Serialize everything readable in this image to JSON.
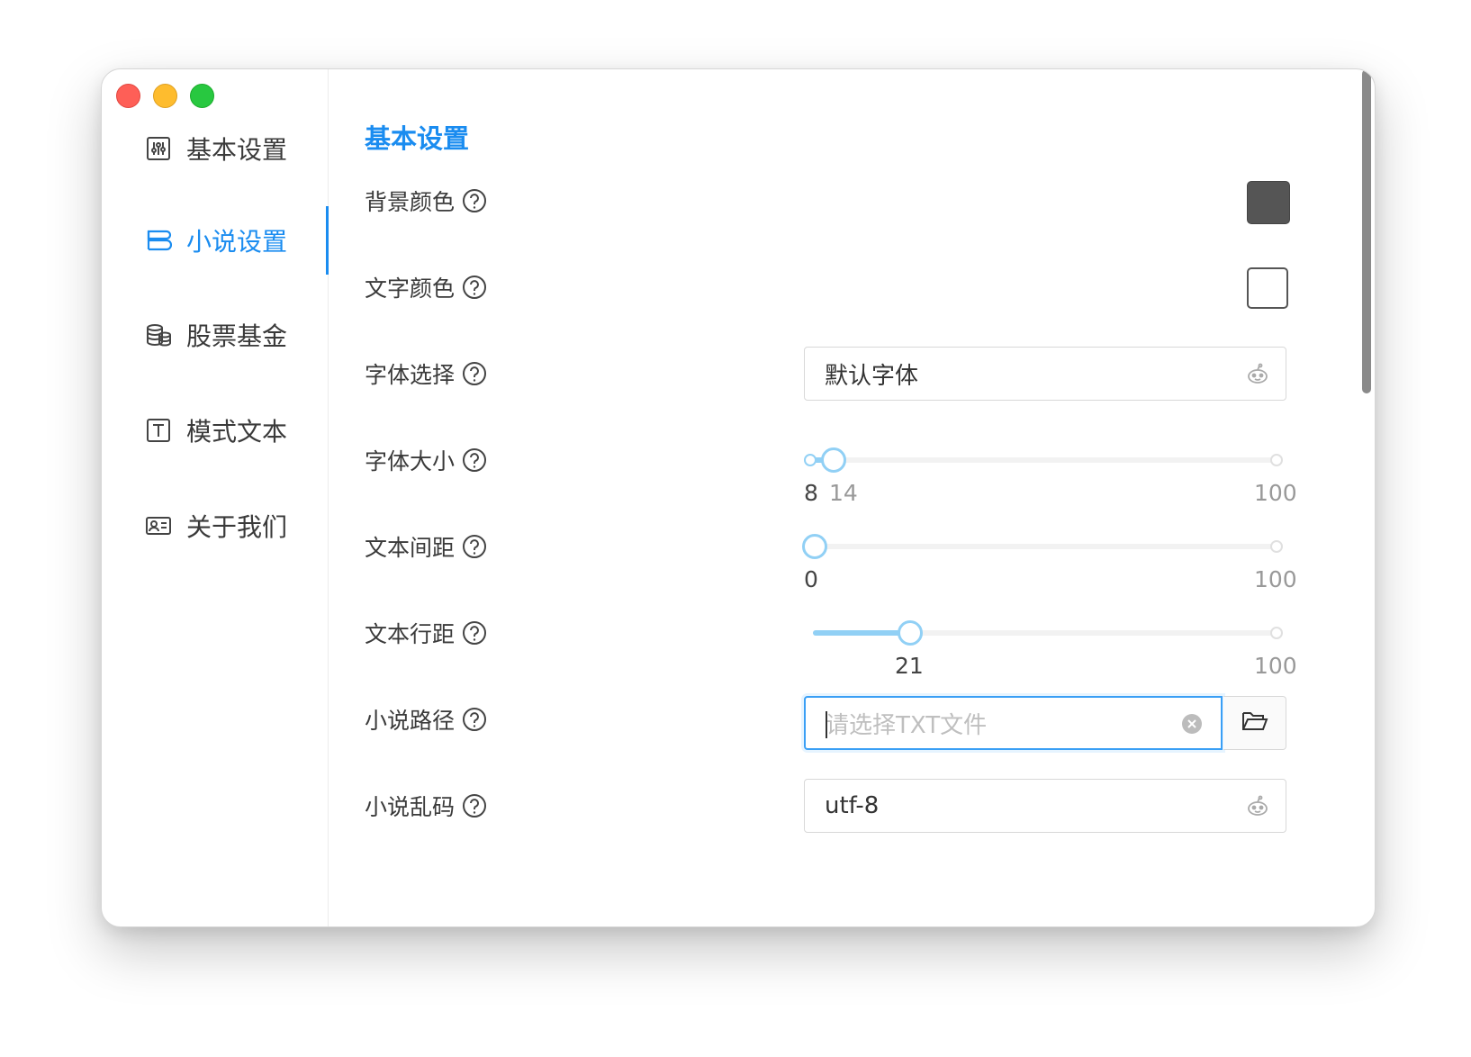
{
  "sidebar": {
    "items": [
      {
        "label": "基本设置",
        "icon": "sliders-icon"
      },
      {
        "label": "小说设置",
        "icon": "book-icon",
        "active": true
      },
      {
        "label": "股票基金",
        "icon": "coins-icon"
      },
      {
        "label": "模式文本",
        "icon": "text-icon"
      },
      {
        "label": "关于我们",
        "icon": "id-card-icon"
      }
    ]
  },
  "content": {
    "title": "基本设置",
    "rows": {
      "bg_color": {
        "label": "背景颜色",
        "value_color": "#555555"
      },
      "text_color": {
        "label": "文字颜色",
        "value_color": "#ffffff"
      },
      "font_family": {
        "label": "字体选择",
        "value": "默认字体"
      },
      "font_size": {
        "label": "字体大小",
        "min": "8",
        "max": "100",
        "value": "14"
      },
      "letter_spacing": {
        "label": "文本间距",
        "min": "0",
        "max": "100",
        "value": 0
      },
      "line_height": {
        "label": "文本行距",
        "max": "100",
        "value": "21"
      },
      "novel_path": {
        "label": "小说路径",
        "placeholder": "请选择TXT文件",
        "value": ""
      },
      "encoding": {
        "label": "小说乱码",
        "value": "utf-8"
      }
    }
  },
  "colors": {
    "accent": "#1a8cf0",
    "slider": "#91d0f5"
  }
}
